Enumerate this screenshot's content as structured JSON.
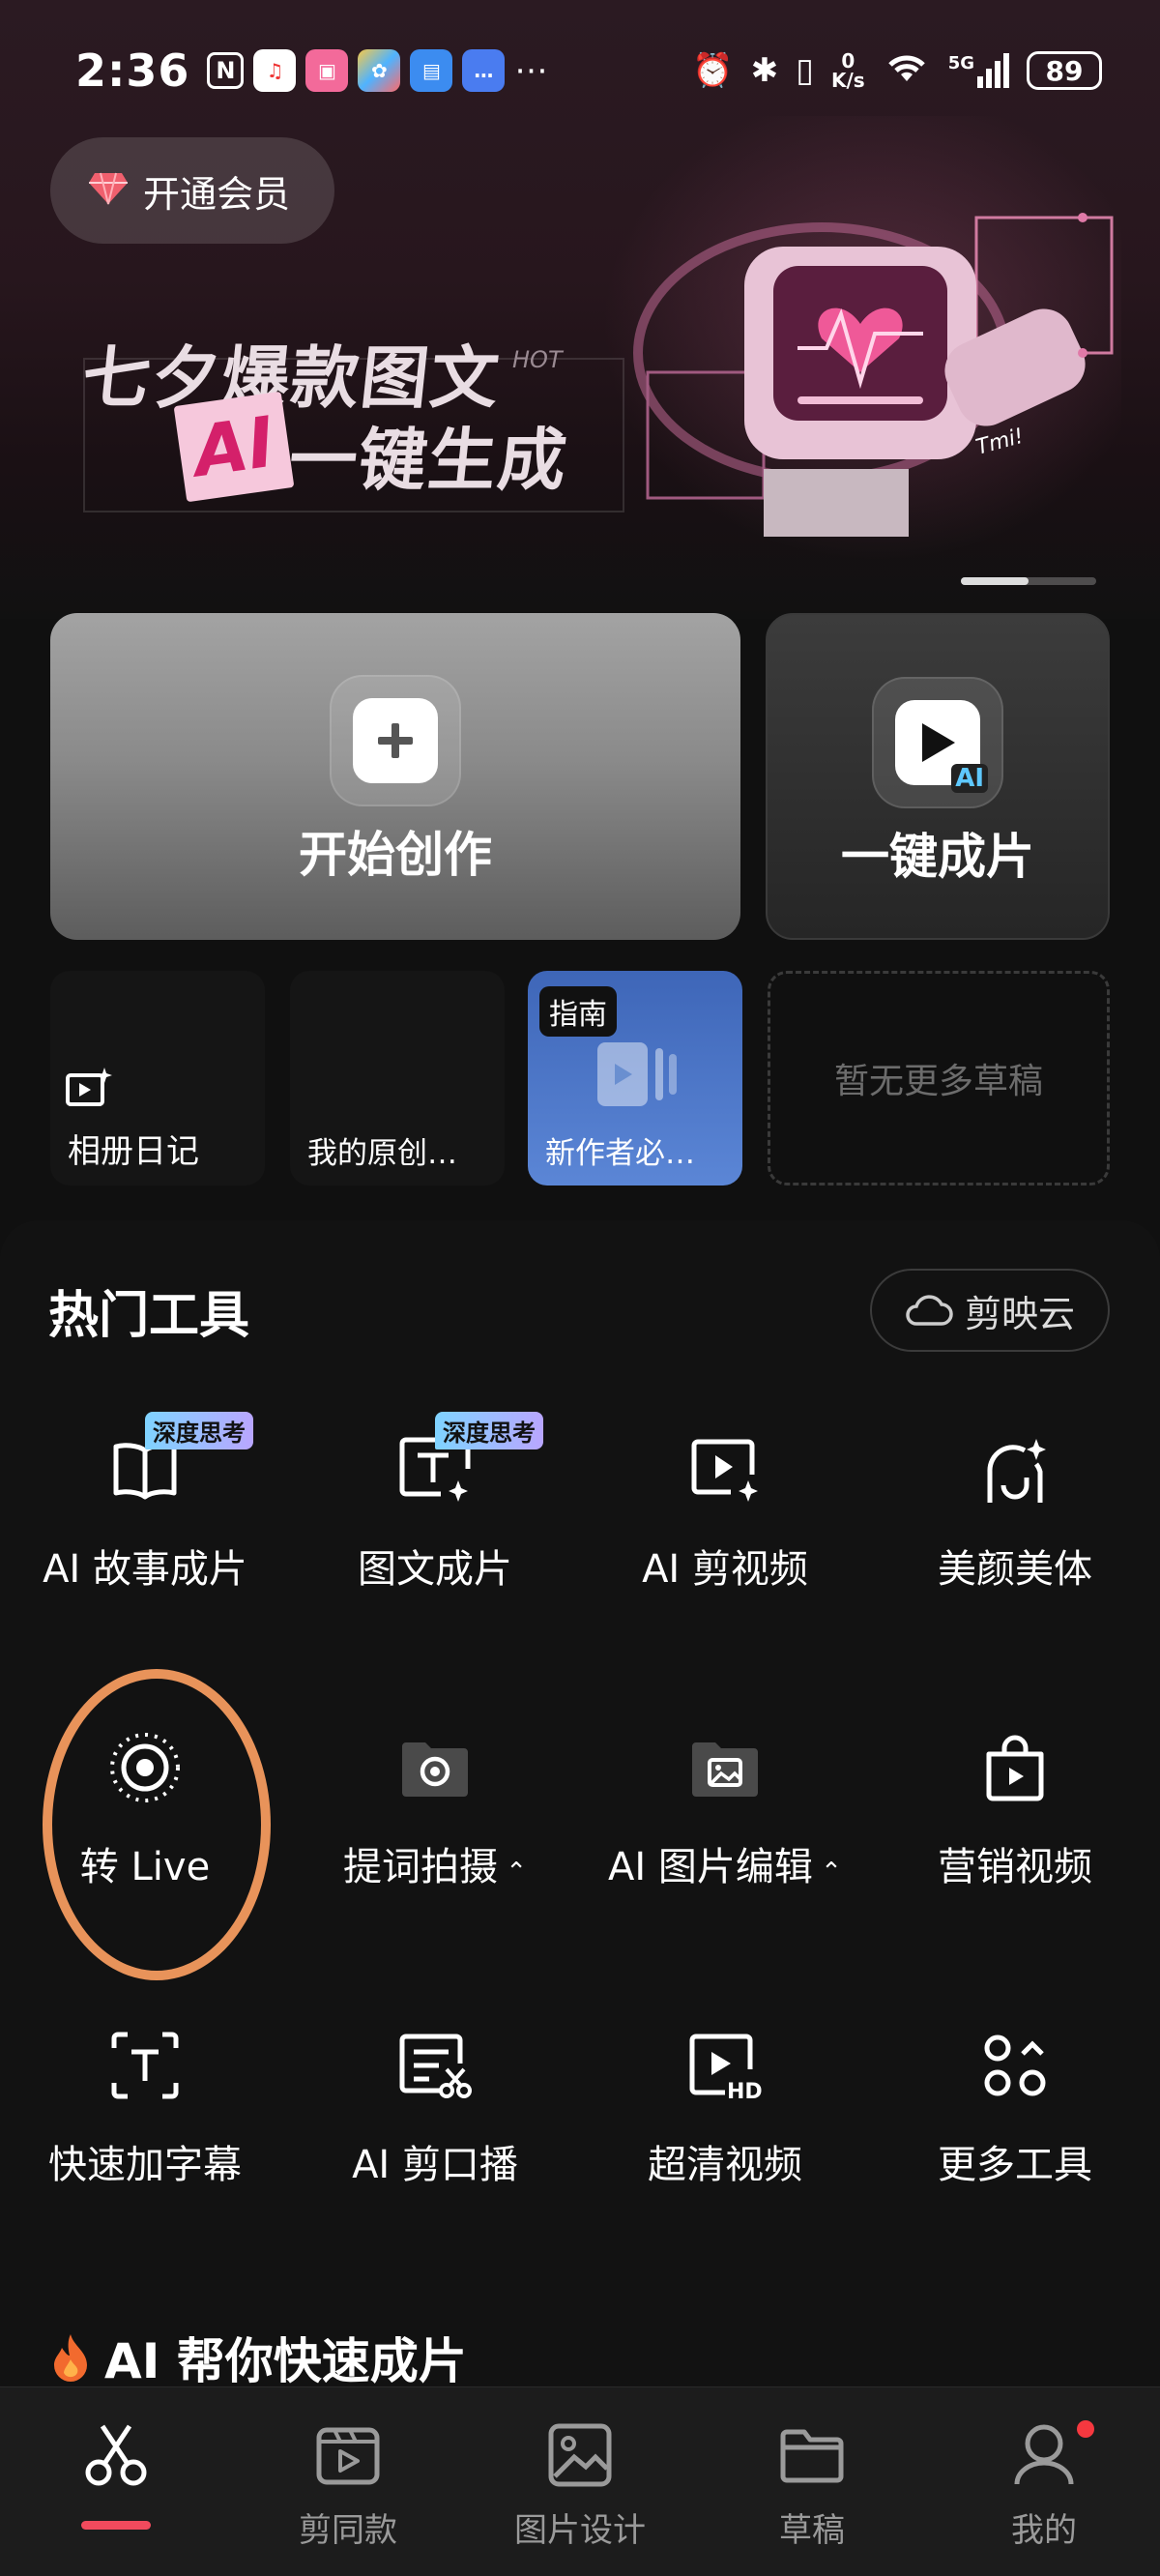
{
  "status_bar": {
    "time": "2:36",
    "net_speed_top": "0",
    "net_speed_unit": "K/s",
    "signal_label": "5G",
    "battery": "89"
  },
  "vip": {
    "label": "开通会员"
  },
  "banner": {
    "title_line1": "七夕爆款图文",
    "hot_tag": "HOT",
    "ai_tag": "AI",
    "title_line2": "一键生成"
  },
  "cards": {
    "create_label": "开始创作",
    "oneclick_label": "一键成片",
    "oneclick_badge": "AI"
  },
  "drafts": [
    {
      "label": "相册日记"
    },
    {
      "label": "我的原创…"
    },
    {
      "badge": "指南",
      "label": "新作者必…"
    }
  ],
  "drafts_empty": "暂无更多草稿",
  "tools": {
    "title": "热门工具",
    "cloud_label": "剪映云",
    "items": [
      {
        "label": "AI 故事成片",
        "badge": "深度思考",
        "icon": "book-icon"
      },
      {
        "label": "图文成片",
        "badge": "深度思考",
        "icon": "text-image-icon"
      },
      {
        "label": "AI 剪视频",
        "icon": "video-sparkle-icon"
      },
      {
        "label": "美颜美体",
        "icon": "beauty-icon"
      },
      {
        "label": "转 Live",
        "icon": "live-icon"
      },
      {
        "label": "提词拍摄",
        "icon": "teleprompter-camera-icon"
      },
      {
        "label": "AI 图片编辑",
        "icon": "image-edit-icon"
      },
      {
        "label": "营销视频",
        "icon": "shopping-bag-icon"
      },
      {
        "label": "快速加字幕",
        "icon": "caption-icon"
      },
      {
        "label": "AI 剪口播",
        "icon": "speech-cut-icon"
      },
      {
        "label": "超清视频",
        "icon": "hd-video-icon"
      },
      {
        "label": "更多工具",
        "icon": "more-tools-icon"
      }
    ]
  },
  "section_title": "AI 帮你快速成片",
  "bottom_nav": [
    {
      "label": "",
      "icon": "scissors-icon",
      "active": true
    },
    {
      "label": "剪同款",
      "icon": "template-icon"
    },
    {
      "label": "图片设计",
      "icon": "image-icon"
    },
    {
      "label": "草稿",
      "icon": "folder-icon"
    },
    {
      "label": "我的",
      "icon": "profile-icon"
    }
  ],
  "colors": {
    "accent_red": "#f04a5d",
    "highlight_ring": "#e8935a",
    "badge_gradient_start": "#7fd3ff",
    "badge_gradient_end": "#b9a6ff"
  }
}
